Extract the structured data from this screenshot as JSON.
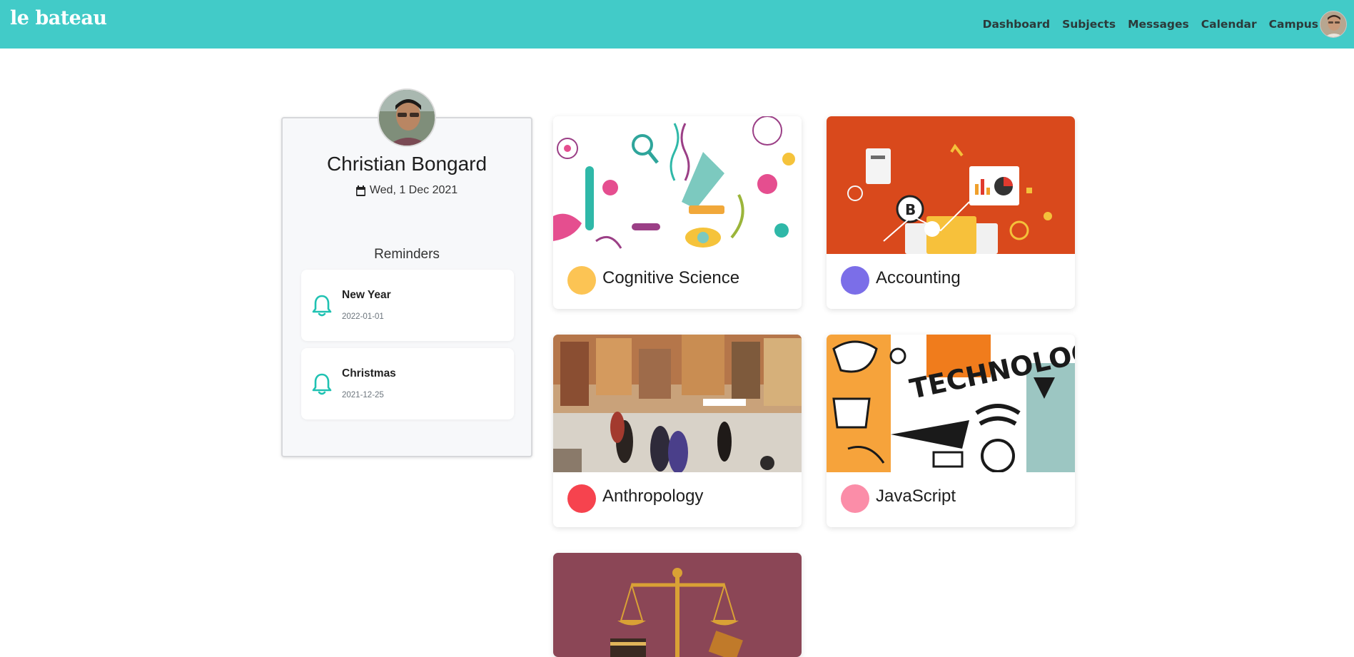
{
  "app": {
    "brand": "le bateau"
  },
  "nav": {
    "items": [
      {
        "label": "Dashboard"
      },
      {
        "label": "Subjects"
      },
      {
        "label": "Messages"
      },
      {
        "label": "Calendar"
      },
      {
        "label": "Campus"
      }
    ],
    "avatar_icon": "user-avatar"
  },
  "profile": {
    "name": "Christian Bongard",
    "date": "Wed, 1 Dec 2021",
    "date_icon": "calendar-icon",
    "reminders_title": "Reminders",
    "reminders": [
      {
        "title": "New Year",
        "date": "2022-01-01",
        "icon": "bell-icon"
      },
      {
        "title": "Christmas",
        "date": "2021-12-25",
        "icon": "bell-icon"
      }
    ]
  },
  "subjects": [
    {
      "name": "Cognitive Science",
      "color": "#fcc454",
      "banner_color": "#ffffff"
    },
    {
      "name": "Accounting",
      "color": "#7b6ee8",
      "banner_color": "#d9491c"
    },
    {
      "name": "Anthropology",
      "color": "#f6434e",
      "banner_color": "#b07a52"
    },
    {
      "name": "JavaScript",
      "color": "#fb8da8",
      "banner_color": "#f6a33b"
    },
    {
      "name": "",
      "color": "",
      "banner_color": "#8b4656"
    }
  ],
  "colors": {
    "topbar": "#42cbc8",
    "accent_bell": "#20c2b2"
  }
}
